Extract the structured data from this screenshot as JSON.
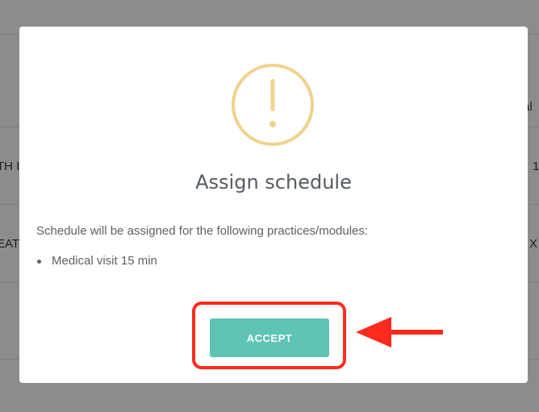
{
  "background": {
    "cells": [
      "al",
      "TH I",
      "1",
      "EAT",
      "X"
    ]
  },
  "modal": {
    "title": "Assign schedule",
    "message": "Schedule will be assigned for the following practices/modules:",
    "items": [
      "Medical visit 15 min"
    ],
    "accept_label": "ACCEPT",
    "icon": "exclamation-circle-icon"
  },
  "annotation": {
    "icon": "arrow-left-icon"
  },
  "colors": {
    "warning": "#f0d28c",
    "accept": "#5ec4b6",
    "highlight": "#ff2a1e"
  }
}
